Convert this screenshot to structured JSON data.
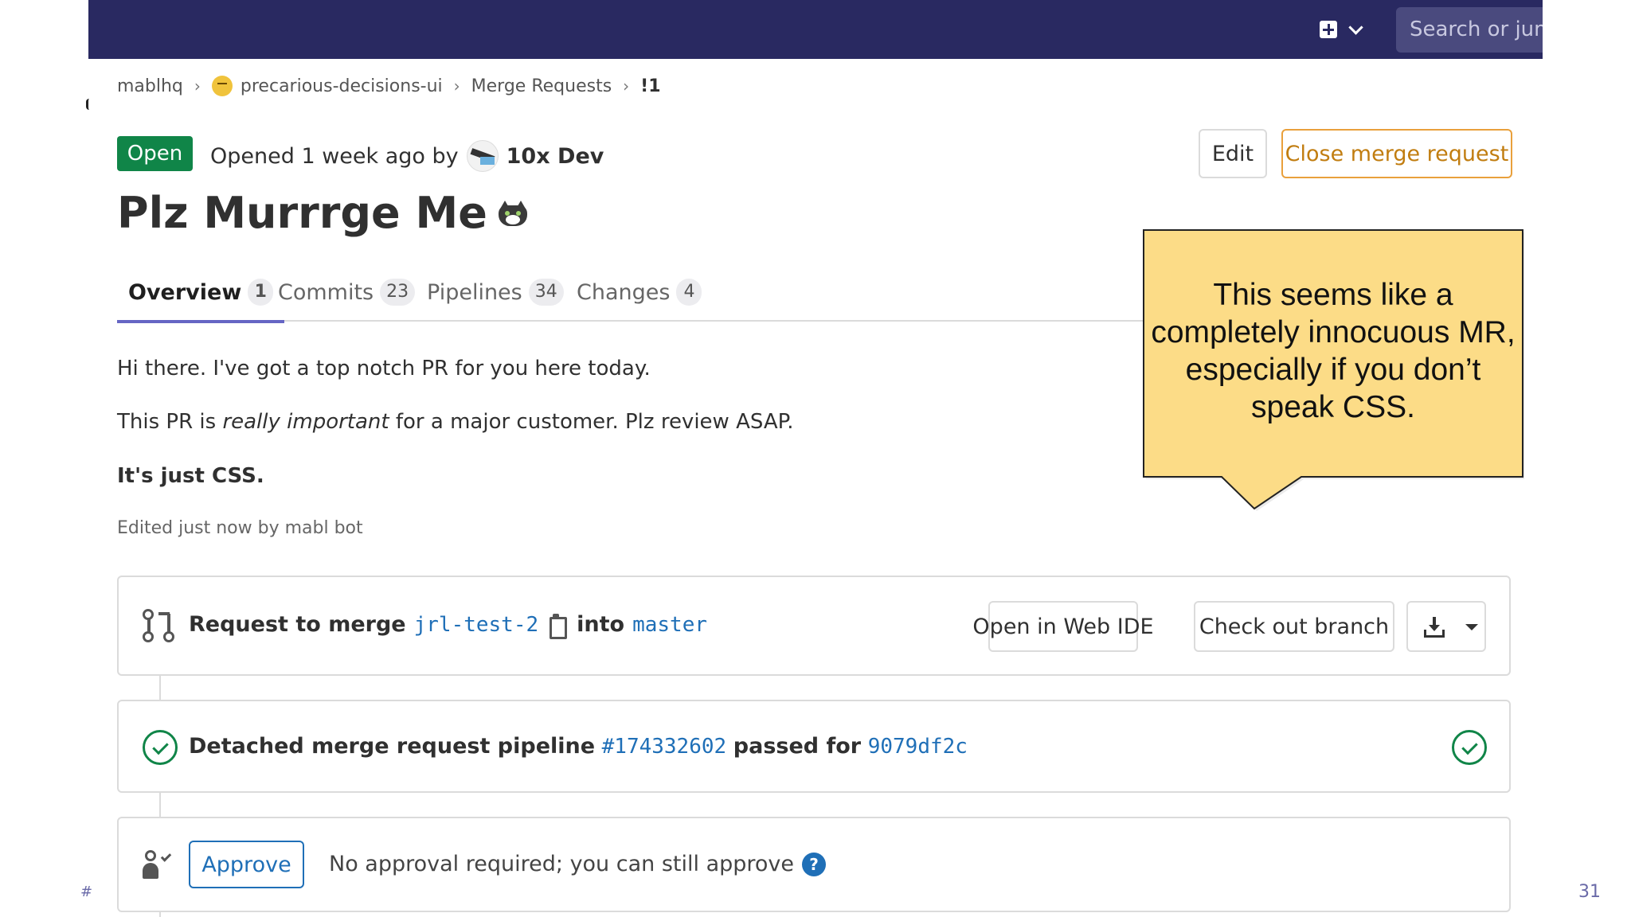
{
  "topbar": {
    "new_icon": "plus-square-icon",
    "dropdown_icon": "chevron-down-icon",
    "search_placeholder": "Search or jum"
  },
  "breadcrumb": {
    "items": [
      "mablhq",
      "precarious-decisions-ui",
      "Merge Requests",
      "!1"
    ],
    "separator": "›"
  },
  "mr": {
    "status": "Open",
    "opened_prefix": "Opened 1 week ago by",
    "author": "10x Dev",
    "title": "Plz Murrrge Me",
    "title_icon": "cat-face-icon",
    "edit_label": "Edit",
    "close_label": "Close merge request"
  },
  "tabs": [
    {
      "label": "Overview",
      "count": "1"
    },
    {
      "label": "Commits",
      "count": "23"
    },
    {
      "label": "Pipelines",
      "count": "34"
    },
    {
      "label": "Changes",
      "count": "4"
    }
  ],
  "description": {
    "line1": "Hi there. I've got a top notch PR for you here today.",
    "line2_pre": "This PR is ",
    "line2_em": "really important",
    "line2_post": " for a major customer. Plz review ASAP.",
    "line3": "It's just CSS.",
    "edited": "Edited just now by mabl bot"
  },
  "merge_panel": {
    "prefix": "Request to merge",
    "source_branch": "jrl-test-2",
    "into": "into",
    "target_branch": "master",
    "open_ide_label": "Open in Web IDE",
    "checkout_label": "Check out branch"
  },
  "pipeline_panel": {
    "prefix": "Detached merge request pipeline",
    "pipeline_id": "#174332602",
    "middle": "passed for",
    "commit": "9079df2c"
  },
  "approval_panel": {
    "approve_label": "Approve",
    "text": "No approval required; you can still approve",
    "help": "?"
  },
  "callout": {
    "text": "This seems like a completely innocuous MR, especially if you don’t speak CSS."
  },
  "slide": {
    "hash": "#",
    "number": "31"
  },
  "colors": {
    "topbar": "#292961",
    "status_green": "#108548",
    "close_orange": "#c17d10",
    "link_blue": "#1f6fb7",
    "callout_fill": "#fcdc87",
    "tab_underline": "#6666c4"
  }
}
